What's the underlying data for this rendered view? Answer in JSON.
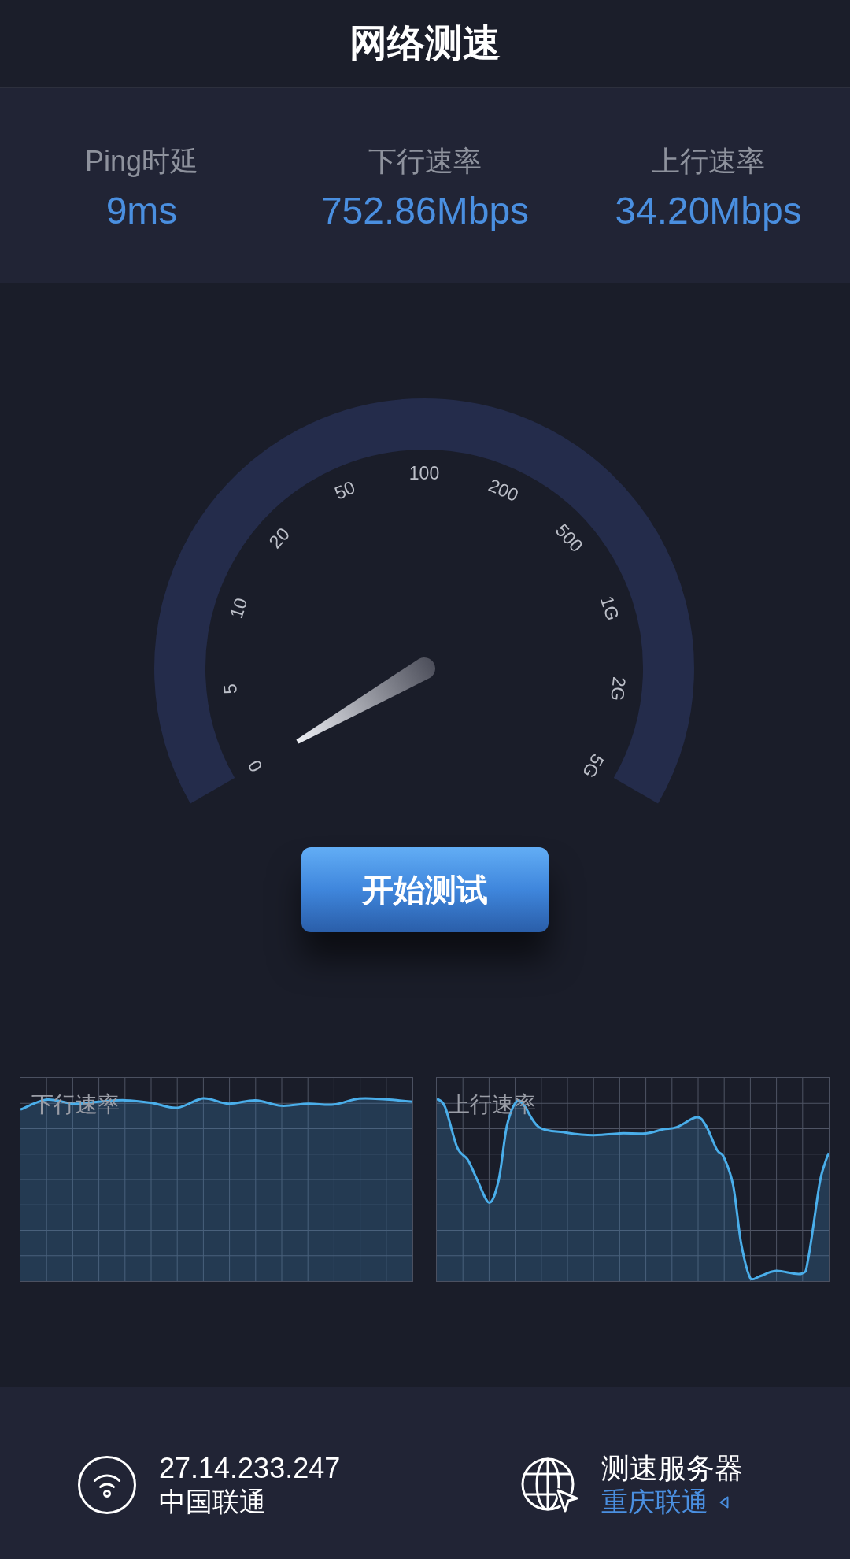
{
  "header": {
    "title": "网络测速"
  },
  "stats": [
    {
      "label": "Ping时延",
      "value": "9ms"
    },
    {
      "label": "下行速率",
      "value": "752.86Mbps"
    },
    {
      "label": "上行速率",
      "value": "34.20Mbps"
    }
  ],
  "gauge": {
    "scale": [
      "0",
      "5",
      "10",
      "20",
      "50",
      "100",
      "200",
      "500",
      "1G",
      "2G",
      "5G"
    ]
  },
  "start_button": {
    "label": "开始测试"
  },
  "charts": [
    {
      "title": "下行速率"
    },
    {
      "title": "上行速率"
    }
  ],
  "footer": {
    "network": {
      "ip": "27.14.233.247",
      "carrier": "中国联通"
    },
    "server": {
      "label": "测速服务器",
      "name": "重庆联通"
    }
  }
}
